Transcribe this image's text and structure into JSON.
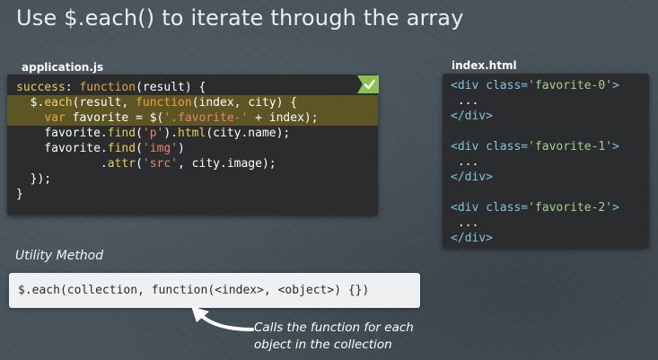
{
  "slide": {
    "title": "Use $.each() to iterate through the array"
  },
  "app_file": {
    "label": "application.js",
    "lines": [
      {
        "t1": "success",
        "t2": ": ",
        "t3": "function",
        "t4": "(result) {"
      },
      {
        "t1": "  $.",
        "t2": "each",
        "t3": "(result, ",
        "t4": "function",
        "t5": "(index, city) {"
      },
      {
        "t1": "    ",
        "t2": "var",
        "t3": " favorite = $(",
        "t4": "'.favorite-'",
        "t5": " + index);"
      },
      {
        "t1": "    favorite.",
        "t2": "find",
        "t3": "(",
        "t4": "'p'",
        "t5": ").",
        "t6": "html",
        "t7": "(city.name);"
      },
      {
        "t1": "    favorite.",
        "t2": "find",
        "t3": "(",
        "t4": "'img'",
        "t5": ")"
      },
      {
        "t1": "            .",
        "t2": "attr",
        "t3": "(",
        "t4": "'src'",
        "t5": ", city.image);"
      },
      {
        "t1": "  });"
      },
      {
        "t1": "}"
      }
    ]
  },
  "index_file": {
    "label": "index.html",
    "blocks": [
      {
        "open_tag": "<div",
        "attr_name": " class=",
        "attr_value": "'favorite-0'",
        "open_end": ">",
        "body": " ...",
        "close_tag": "</div>"
      },
      {
        "open_tag": "<div",
        "attr_name": " class=",
        "attr_value": "'favorite-1'",
        "open_end": ">",
        "body": " ...",
        "close_tag": "</div>"
      },
      {
        "open_tag": "<div",
        "attr_name": " class=",
        "attr_value": "'favorite-2'",
        "open_end": ">",
        "body": " ...",
        "close_tag": "</div>"
      }
    ]
  },
  "utility": {
    "label": "Utility Method",
    "signature": "$.each(collection, function(<index>, <object>) {})"
  },
  "callout": {
    "line1": "Calls the function for each",
    "line2": "object in the collection"
  },
  "icons": {
    "badge": "checkmark-icon",
    "arrow": "curved-arrow-icon"
  },
  "colors": {
    "background": "#47525a",
    "code_bg": "#2a2c2d",
    "highlight": "#5e5524",
    "keyword": "#f0a23c",
    "function": "#e8d05a",
    "string": "#e7856b",
    "tag": "#7fc7d9",
    "badge": "#8cc152"
  }
}
